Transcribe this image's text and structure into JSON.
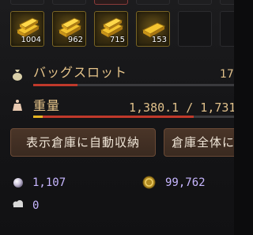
{
  "inventory": {
    "items": [
      {
        "name": "gold-bar",
        "quantity": "1004"
      },
      {
        "name": "gold-bar",
        "quantity": "962"
      },
      {
        "name": "gold-bar",
        "quantity": "715"
      },
      {
        "name": "gold-bar",
        "quantity": "153"
      }
    ]
  },
  "bag_slots": {
    "label": "バッグスロット",
    "count": "17",
    "fill_fraction": 0.22
  },
  "weight": {
    "label": "重量",
    "value": "1,380.1 / 1,731",
    "fill_fraction": 0.8
  },
  "buttons": {
    "auto_store_label": "表示倉庫に自動収納",
    "warehouse_all_label": "倉庫全体に"
  },
  "currency": {
    "pearl_value": "1,107",
    "silver_value": "99,762",
    "other_value": "0"
  },
  "colors": {
    "bar_red": "#c0392b",
    "weight_yellow": "#e6b422",
    "label_gold": "#e6c48a",
    "currency_purple": "#c7b6ff"
  }
}
